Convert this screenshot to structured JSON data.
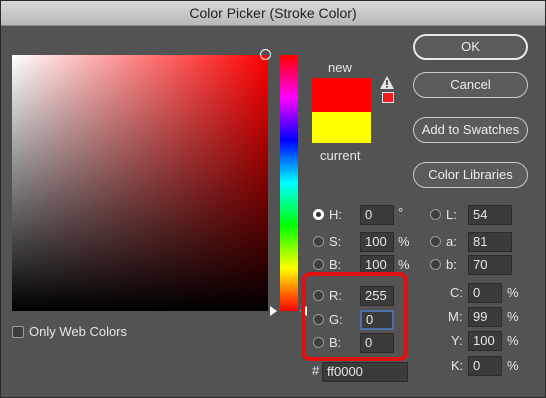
{
  "window": {
    "title": "Color Picker (Stroke Color)"
  },
  "preview": {
    "new_label": "new",
    "current_label": "current",
    "new_color": "#ff0000",
    "current_color": "#ffff00",
    "warning_icon": "gamut-warning-icon"
  },
  "buttons": {
    "ok": "OK",
    "cancel": "Cancel",
    "add_to_swatches": "Add to Swatches",
    "color_libraries": "Color Libraries"
  },
  "hsb": {
    "h": {
      "label": "H:",
      "value": "0",
      "unit": "°",
      "selected": true
    },
    "s": {
      "label": "S:",
      "value": "100",
      "unit": "%"
    },
    "b": {
      "label": "B:",
      "value": "100",
      "unit": "%"
    }
  },
  "rgb": {
    "r": {
      "label": "R:",
      "value": "255"
    },
    "g": {
      "label": "G:",
      "value": "0"
    },
    "b": {
      "label": "B:",
      "value": "0"
    }
  },
  "lab": {
    "l": {
      "label": "L:",
      "value": "54"
    },
    "a": {
      "label": "a:",
      "value": "81"
    },
    "b": {
      "label": "b:",
      "value": "70"
    }
  },
  "cmyk": {
    "c": {
      "label": "C:",
      "value": "0",
      "unit": "%"
    },
    "m": {
      "label": "M:",
      "value": "99",
      "unit": "%"
    },
    "y": {
      "label": "Y:",
      "value": "100",
      "unit": "%"
    },
    "k": {
      "label": "K:",
      "value": "0",
      "unit": "%"
    }
  },
  "hex": {
    "label": "#",
    "value": "ff0000"
  },
  "options": {
    "only_web_colors": "Only Web Colors"
  },
  "colors": {
    "highlight": "#e11010",
    "dialog_bg": "#535353"
  }
}
